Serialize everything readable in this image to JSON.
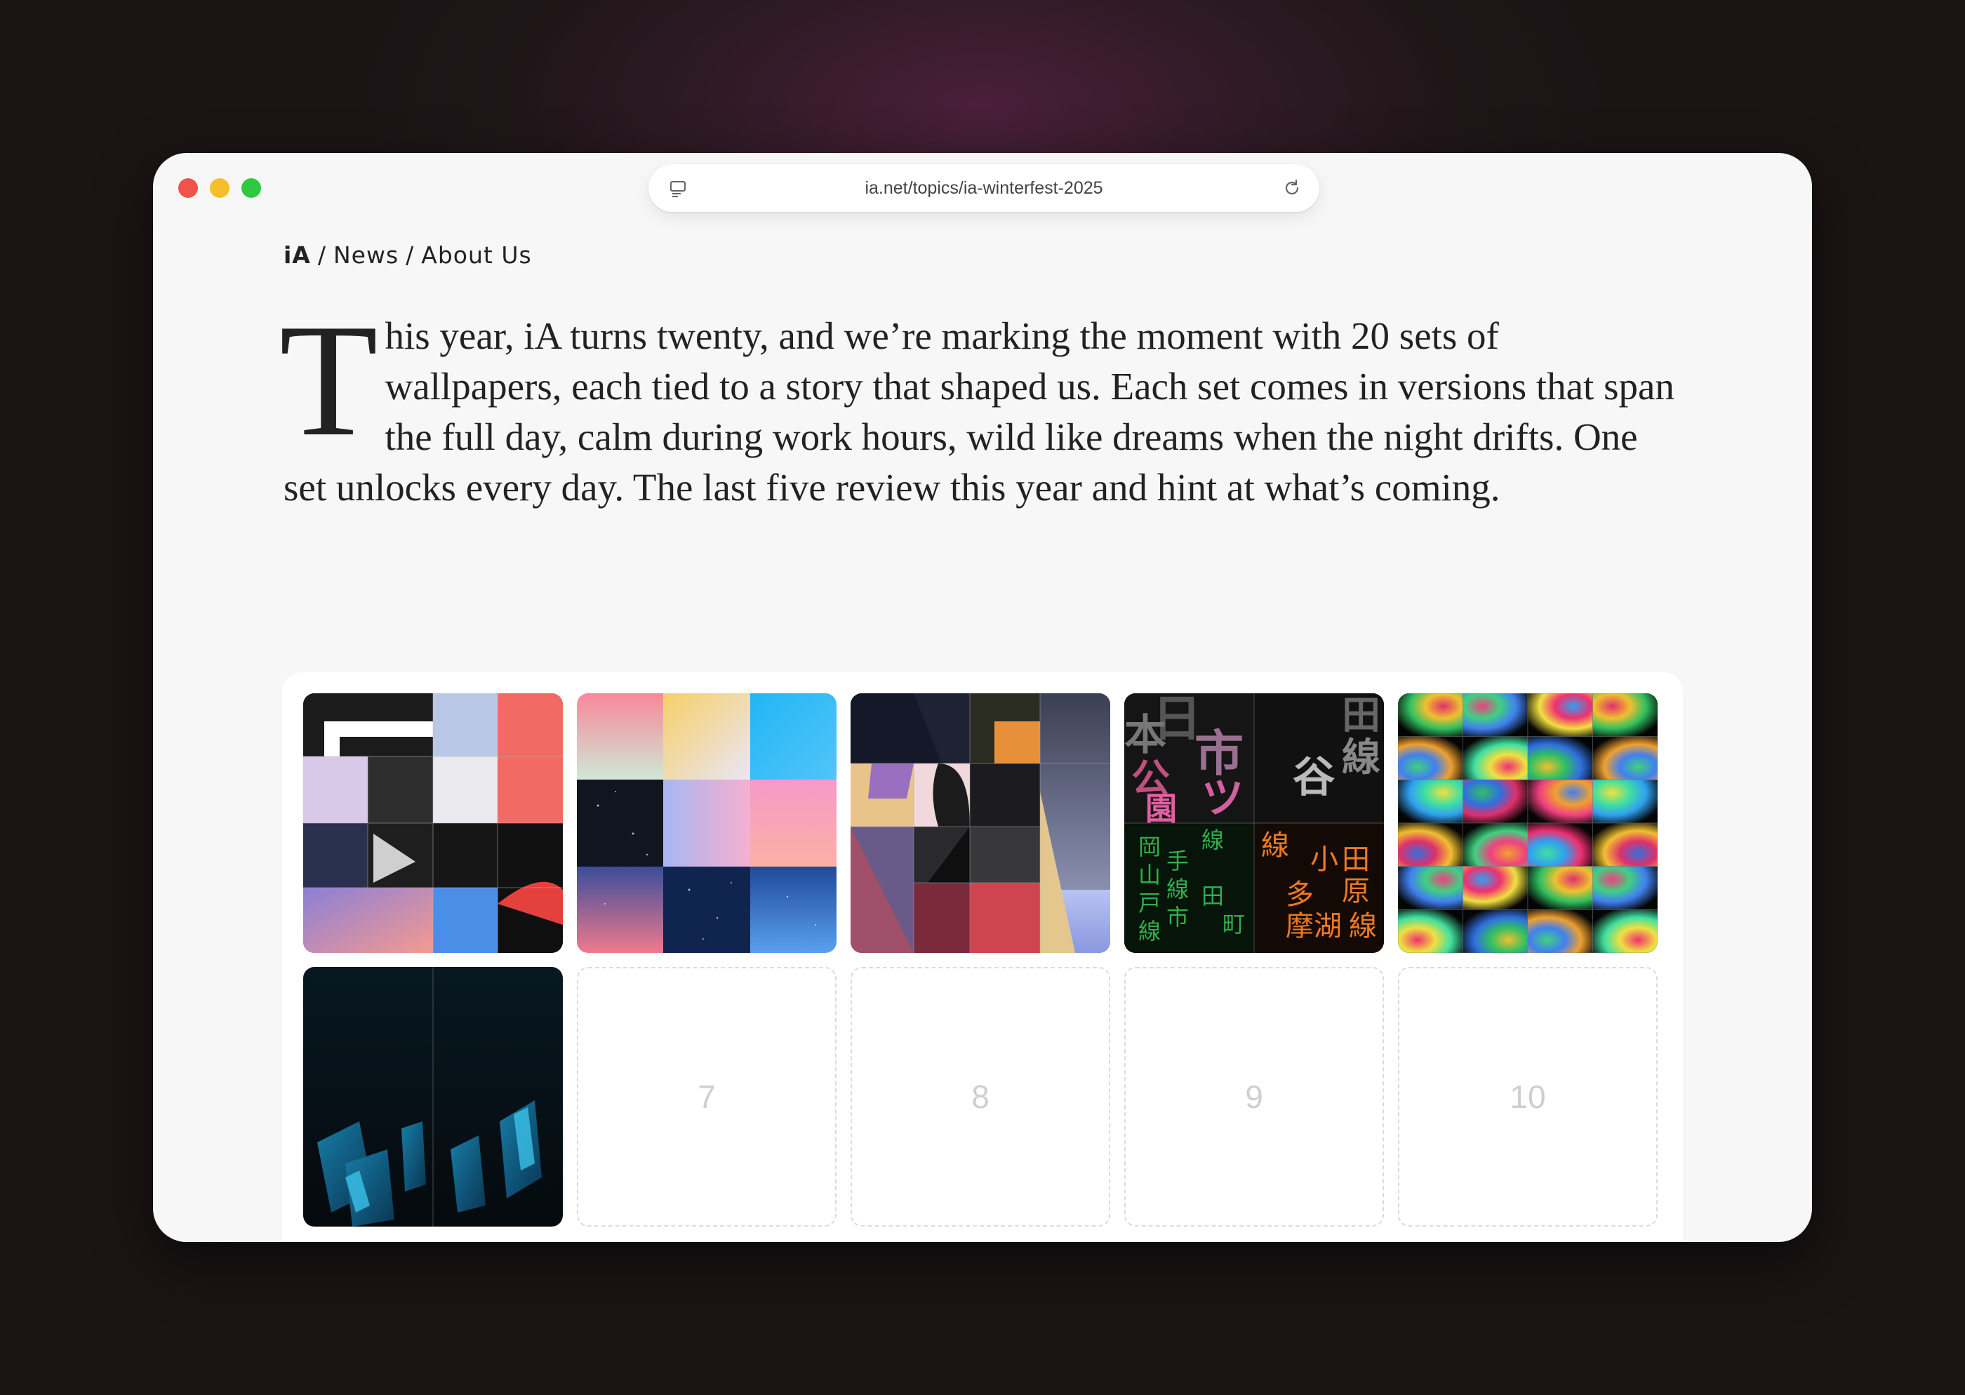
{
  "browser": {
    "url": "ia.net/topics/ia-winterfest-2025"
  },
  "breadcrumb": [
    "iA",
    "News",
    "About Us"
  ],
  "intro": {
    "dropcap": "T",
    "text": "his year, iA turns twenty, and we’re marking the moment with 20 sets of wallpapers, each tied to a story that shaped us. Each set comes in versions that span the full day, calm during work hours, wild like dreams when the night drifts. One set unlocks every day. The last five review this year and hint at what’s coming."
  },
  "wallpaper_sets": {
    "locked_numbers": [
      "7",
      "8",
      "9",
      "10"
    ],
    "kanji": {
      "k1": "日",
      "k2": "市",
      "k3": "ツ",
      "k4": "谷",
      "k5": "田",
      "k6": "線",
      "k7": "本",
      "k8": "公",
      "k9": "園",
      "k10": "小",
      "k11": "原",
      "k12": "多",
      "k13": "摩",
      "k14": "湖"
    }
  }
}
